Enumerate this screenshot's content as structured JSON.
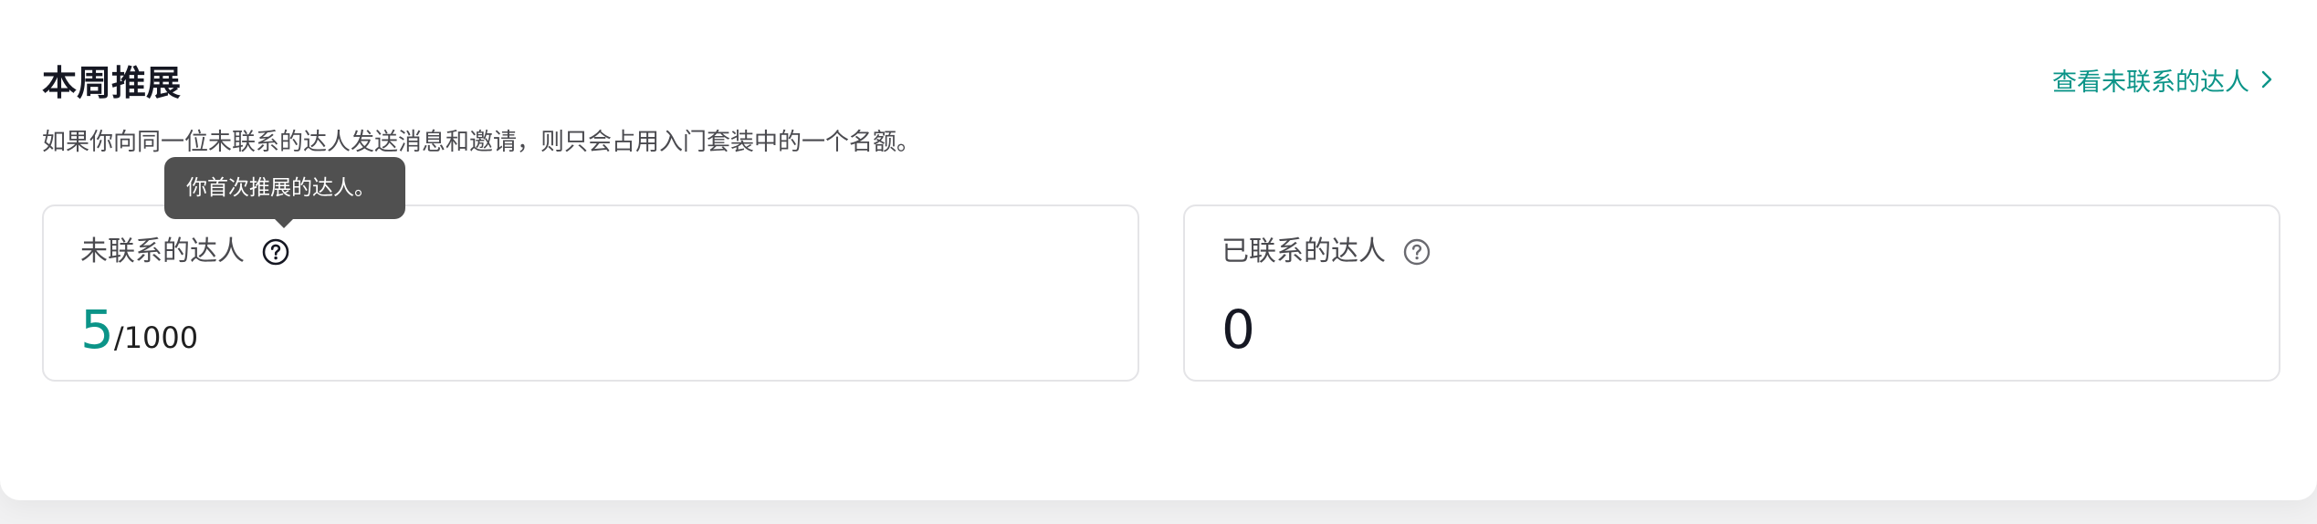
{
  "section": {
    "title": "本周推展",
    "description": "如果你向同一位未联系的达人发送消息和邀请，则只会占用入门套装中的一个名额。",
    "view_link": "查看未联系的达人"
  },
  "cards": [
    {
      "label": "未联系的达人",
      "value": "5",
      "total": "/1000",
      "accent": "#0b9488"
    },
    {
      "label": "已联系的达人",
      "value": "0"
    }
  ],
  "tooltip": {
    "text": "你首次推展的达人。"
  },
  "icons": {
    "help": "question-circle-icon",
    "chevron": "chevron-right-icon"
  }
}
